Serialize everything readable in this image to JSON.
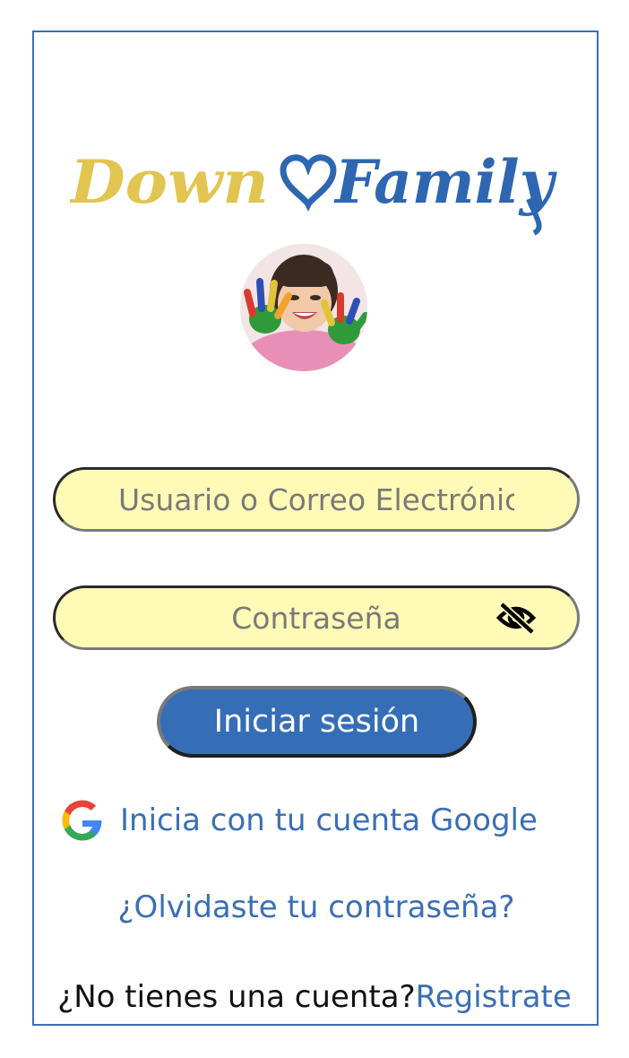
{
  "brand": {
    "word_left": "Down",
    "word_right": "Family",
    "color_left": "#e2c451",
    "color_right": "#2e66b2"
  },
  "avatar_icon": "child-painted-hands-photo",
  "login_form": {
    "username_placeholder": "Usuario o Correo Electrónico",
    "username_value": "",
    "password_placeholder": "Contraseña",
    "password_value": "",
    "password_toggle_icon": "eye-off-icon",
    "submit_label": "Iniciar sesión"
  },
  "google_signin": {
    "icon": "google-icon",
    "label": "Inicia con tu cuenta Google"
  },
  "forgot_password_label": "¿Olvidaste tu contraseña?",
  "signup": {
    "prompt": "¿No tienes una cuenta?",
    "link_label": "Registrate"
  },
  "colors": {
    "field_background": "#fffbb6",
    "accent_blue": "#356db6",
    "link_blue": "#3a6fb5",
    "frame_border": "#3a6fb5"
  }
}
